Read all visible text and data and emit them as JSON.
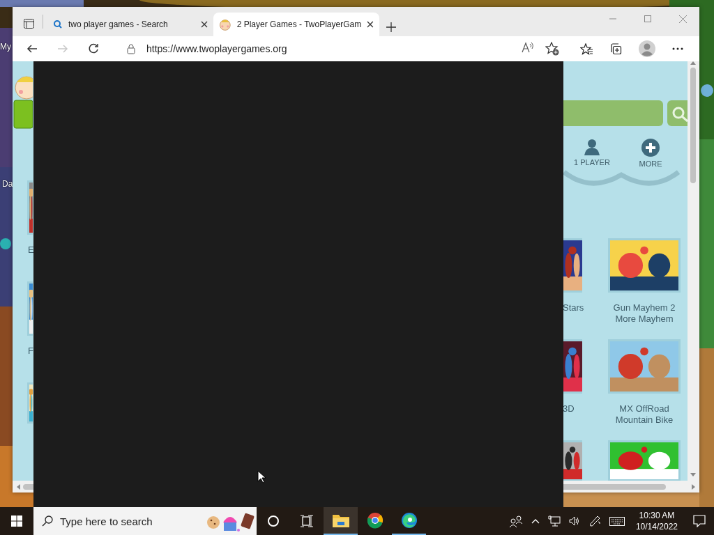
{
  "desktop": {
    "icons": [
      {
        "label": "My"
      },
      {
        "label": "Da"
      }
    ]
  },
  "browser": {
    "tabs": [
      {
        "title": "two player games - Search",
        "selected": false,
        "kind": "search"
      },
      {
        "title": "2 Player Games - TwoPlayerGam",
        "selected": true,
        "kind": "face"
      }
    ],
    "nav_buttons": [
      {
        "kind": "back",
        "disabled": false
      },
      {
        "kind": "forward",
        "disabled": true
      },
      {
        "kind": "refresh",
        "disabled": false
      }
    ],
    "address": "https://www.twoplayergames.org",
    "page": {
      "nav": [
        {
          "label": "1 PLAYER",
          "kind": "player"
        },
        {
          "label": "MORE",
          "kind": "more"
        }
      ],
      "left_games": [
        {
          "kind": "picture",
          "title": "E"
        },
        {
          "kind": "picture",
          "title": "F"
        },
        {
          "kind": "picture"
        }
      ],
      "right_games": [
        {
          "kind": "picture",
          "title": "Stars"
        },
        {
          "kind": "picture",
          "title": "Gun Mayhem 2 More Mayhem"
        },
        {
          "kind": "picture",
          "title": "3D"
        },
        {
          "kind": "picture",
          "title": "MX OffRoad Mountain Bike"
        },
        {
          "kind": "picture"
        },
        {
          "kind": "picture"
        }
      ]
    }
  },
  "taskbar": {
    "search_placeholder": "Type here to search",
    "apps": [
      {
        "kind": "explorer",
        "running": true,
        "selected": true
      },
      {
        "kind": "chrome",
        "running": false,
        "selected": false
      },
      {
        "kind": "edge",
        "running": true,
        "selected": false
      }
    ],
    "time": "10:30 AM",
    "date": "10/14/2022"
  }
}
